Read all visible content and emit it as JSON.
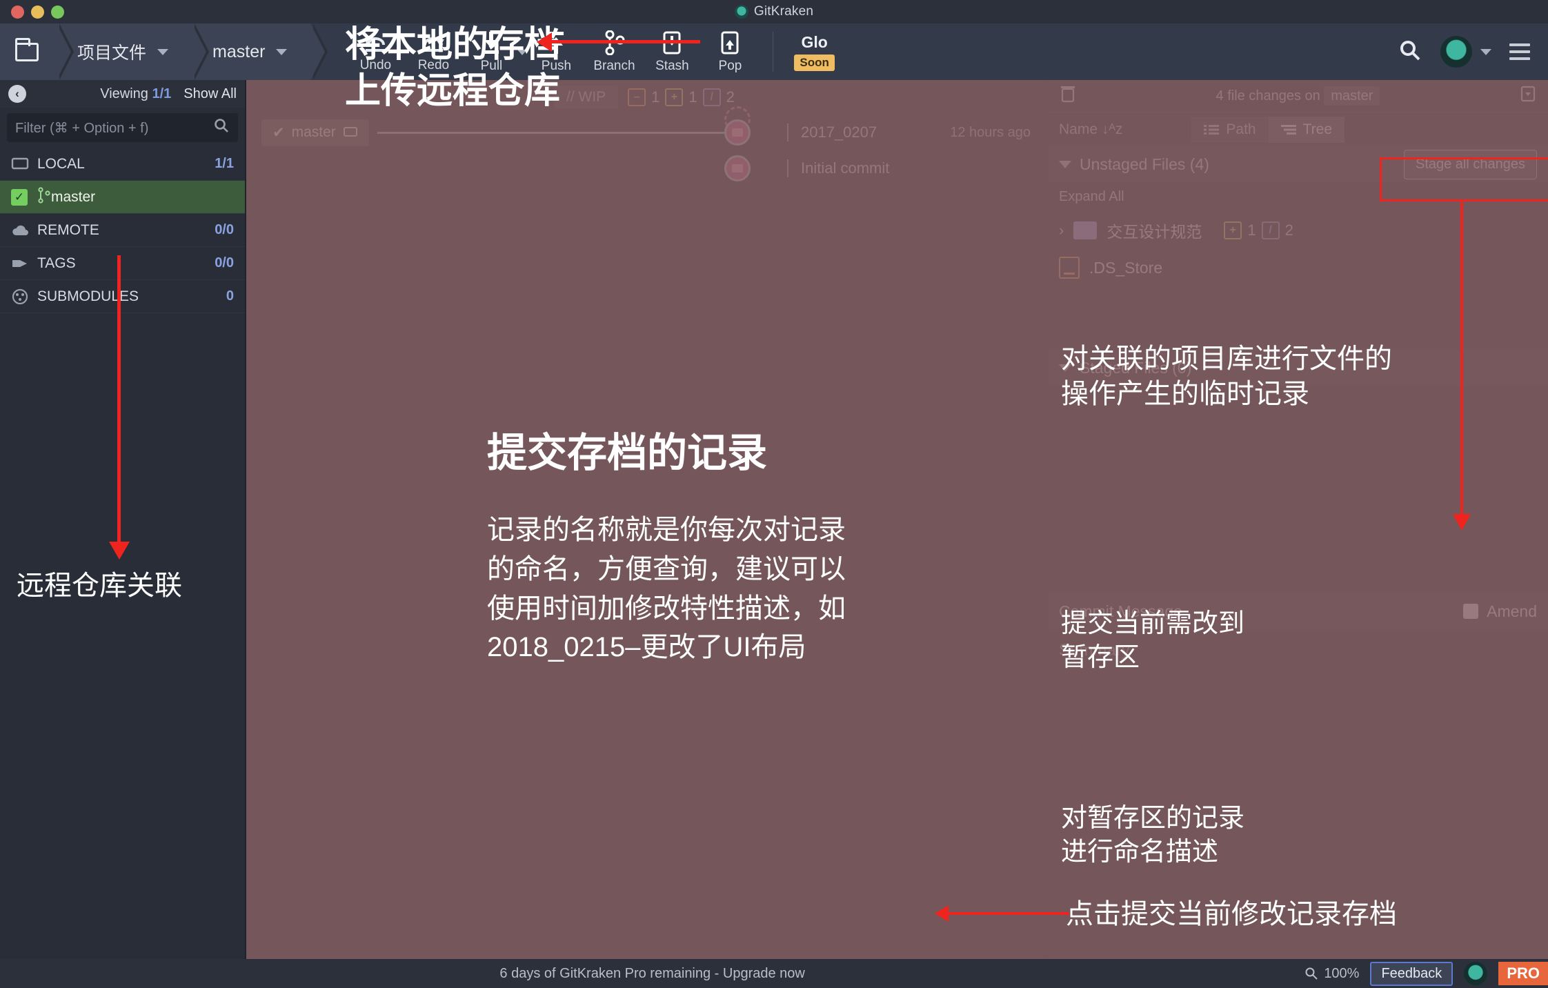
{
  "window": {
    "title": "GitKraken"
  },
  "toolbar": {
    "repo_label": "项目文件",
    "branch_label": "master",
    "tools": [
      {
        "name": "undo",
        "label": "Undo"
      },
      {
        "name": "redo",
        "label": "Redo"
      },
      {
        "name": "pull",
        "label": "Pull"
      },
      {
        "name": "push",
        "label": "Push"
      },
      {
        "name": "branch",
        "label": "Branch"
      },
      {
        "name": "stash",
        "label": "Stash"
      },
      {
        "name": "pop",
        "label": "Pop"
      }
    ],
    "glo_label": "Glo",
    "glo_badge": "Soon"
  },
  "sidebar": {
    "viewing_label": "Viewing",
    "viewing_count": "1/1",
    "show_all": "Show All",
    "filter_placeholder": "Filter (⌘ + Option + f)",
    "sections": [
      {
        "label": "LOCAL",
        "count": "1/1"
      },
      {
        "label": "REMOTE",
        "count": "0/0"
      },
      {
        "label": "TAGS",
        "count": "0/0"
      },
      {
        "label": "SUBMODULES",
        "count": "0"
      }
    ],
    "branch_name": "master"
  },
  "graph": {
    "wip_label": "// WIP",
    "wip_modified": "1",
    "wip_added": "1",
    "wip_renamed": "2",
    "branch_chip": "master",
    "commits": [
      {
        "message": "2017_0207",
        "time": "12 hours ago"
      },
      {
        "message": "Initial commit",
        "time": ""
      }
    ]
  },
  "right_panel": {
    "changes_text": "4 file changes on",
    "changes_branch": "master",
    "sort_label": "Name",
    "view_path": "Path",
    "view_tree": "Tree",
    "unstaged_header": "Unstaged Files (4)",
    "stage_all_label": "Stage all changes",
    "expand_all": "Expand All",
    "files": [
      {
        "name": "交互设计规范",
        "type": "folder",
        "added": "1",
        "renamed": "2"
      },
      {
        "name": ".DS_Store",
        "type": "file"
      }
    ],
    "staged_header": "Staged Files (0)",
    "commit_message_header": "Commit Message",
    "amend_label": "Amend",
    "summary_placeholder": "Summary"
  },
  "annotations": {
    "top_toolbar": {
      "line1": "将本地的存档",
      "line2": "上传远程仓库"
    },
    "sidebar_remote": "远程仓库关联",
    "center_title": "提交存档的记录",
    "center_body": "记录的名称就是你每次对记录的命名，方便查询，建议可以使用时间加修改特性描述，如2018_0215–更改了UI布局",
    "unstaged_note": {
      "line1": "对关联的项目库进行文件的",
      "line2": "操作产生的临时记录"
    },
    "staged_note": {
      "line1": "提交当前需改到",
      "line2": "暂存区"
    },
    "commit_msg_note": {
      "line1": "对暂存区的记录",
      "line2": "进行命名描述"
    },
    "commit_btn_note": "点击提交当前修改记录存档"
  },
  "status_bar": {
    "message": "6 days of GitKraken Pro remaining - Upgrade now",
    "zoom": "100%",
    "feedback": "Feedback",
    "pro_badge": "PRO"
  }
}
